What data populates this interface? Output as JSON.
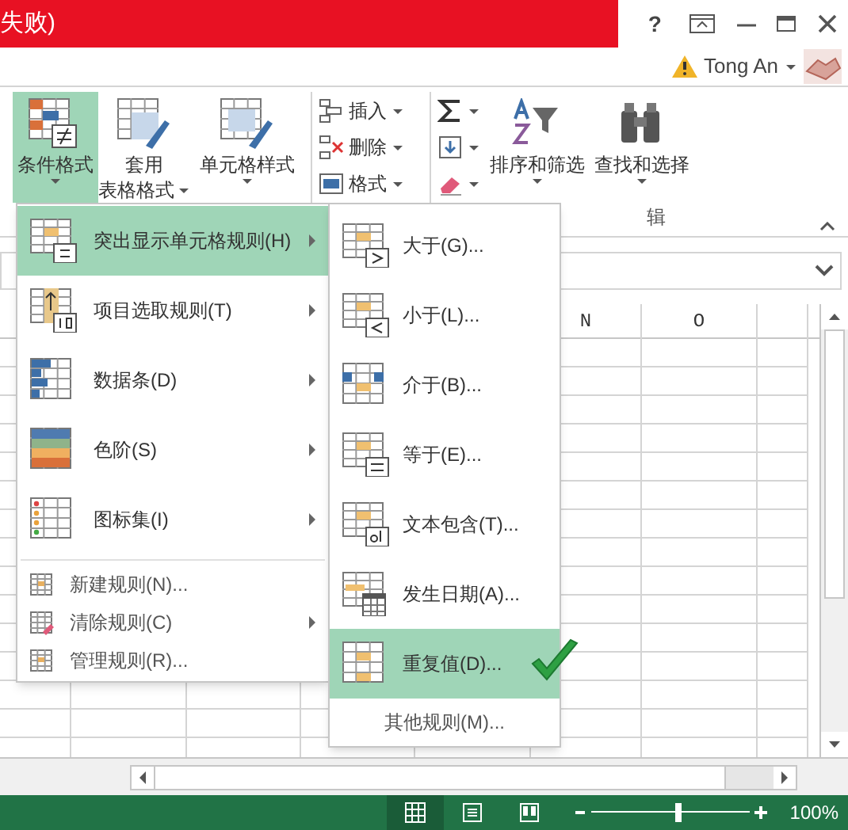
{
  "title_bar": {
    "title": "失败)",
    "help": "?"
  },
  "account": {
    "user": "Tong An"
  },
  "ribbon": {
    "large_buttons": [
      {
        "label": "条件格式",
        "selected": true
      },
      {
        "label": "套用",
        "label2": "表格格式",
        "selected": false
      },
      {
        "label": "单元格样式",
        "selected": false
      }
    ],
    "cell_buttons": [
      {
        "label": "插入"
      },
      {
        "label": "删除"
      },
      {
        "label": "格式"
      }
    ],
    "edit_buttons": [
      {
        "label": "排序和筛选"
      },
      {
        "label": "查找和选择"
      }
    ],
    "group_label": "辑"
  },
  "sheet": {
    "columns": [
      "N",
      "O"
    ]
  },
  "menu": {
    "items": [
      {
        "label": "突出显示单元格规则(H)",
        "kind": "large",
        "selected": true,
        "submenu": true
      },
      {
        "label": "项目选取规则(T)",
        "kind": "large",
        "selected": false,
        "submenu": true
      },
      {
        "label": "数据条(D)",
        "kind": "large",
        "selected": false,
        "submenu": true
      },
      {
        "label": "色阶(S)",
        "kind": "large",
        "selected": false,
        "submenu": true
      },
      {
        "label": "图标集(I)",
        "kind": "large",
        "selected": false,
        "submenu": true
      },
      {
        "label": "新建规则(N)...",
        "kind": "small",
        "selected": false,
        "submenu": false
      },
      {
        "label": "清除规则(C)",
        "kind": "small",
        "selected": false,
        "submenu": true
      },
      {
        "label": "管理规则(R)...",
        "kind": "small",
        "selected": false,
        "submenu": false
      }
    ]
  },
  "submenu": {
    "items": [
      {
        "label": "大于(G)...",
        "selected": false
      },
      {
        "label": "小于(L)...",
        "selected": false
      },
      {
        "label": "介于(B)...",
        "selected": false
      },
      {
        "label": "等于(E)...",
        "selected": false
      },
      {
        "label": "文本包含(T)...",
        "selected": false
      },
      {
        "label": "发生日期(A)...",
        "selected": false
      },
      {
        "label": "重复值(D)...",
        "selected": true
      }
    ],
    "footer": "其他规则(M)...",
    "checkmark": true
  },
  "status_bar": {
    "views": [
      {
        "kind": "normal",
        "selected": true
      },
      {
        "kind": "page_layout",
        "selected": false
      },
      {
        "kind": "page_break",
        "selected": false
      }
    ],
    "zoom": {
      "level": 0.55,
      "label": "100%"
    }
  }
}
